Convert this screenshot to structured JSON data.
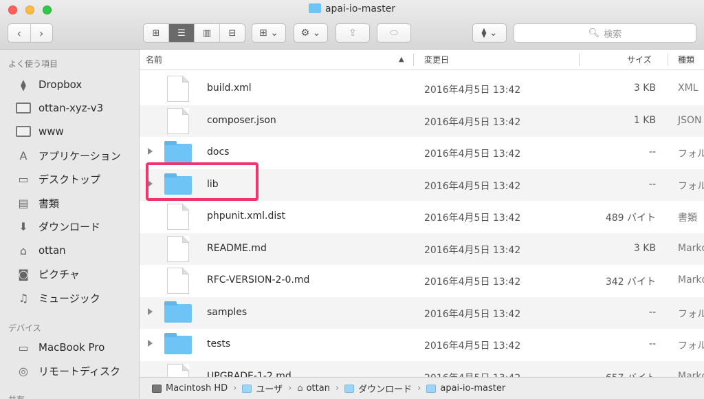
{
  "window": {
    "title": "apai-io-master"
  },
  "toolbar": {
    "back": "‹",
    "forward": "›",
    "views": [
      "⊞",
      "☰",
      "▥",
      "⊟"
    ],
    "arrange": "⊞ ⌄",
    "action": "⚙ ⌄",
    "share": "⇪",
    "tag": "⬭",
    "dropbox": "⧫ ⌄",
    "search_placeholder": "検索"
  },
  "sidebar": {
    "favorites_header": "よく使う項目",
    "favorites": [
      {
        "label": "Dropbox",
        "icon": "dropbox-icon"
      },
      {
        "label": "ottan-xyz-v3",
        "icon": "folder-icon"
      },
      {
        "label": "www",
        "icon": "folder-icon"
      },
      {
        "label": "アプリケーション",
        "icon": "applications-icon"
      },
      {
        "label": "デスクトップ",
        "icon": "desktop-icon"
      },
      {
        "label": "書類",
        "icon": "documents-icon"
      },
      {
        "label": "ダウンロード",
        "icon": "downloads-icon"
      },
      {
        "label": "ottan",
        "icon": "home-icon"
      },
      {
        "label": "ピクチャ",
        "icon": "pictures-icon"
      },
      {
        "label": "ミュージック",
        "icon": "music-icon"
      }
    ],
    "devices_header": "デバイス",
    "devices": [
      {
        "label": "MacBook Pro",
        "icon": "laptop-icon"
      },
      {
        "label": "リモートディスク",
        "icon": "disc-icon"
      }
    ],
    "third_header": "共有"
  },
  "columns": {
    "name": "名前",
    "modified": "変更日",
    "size": "サイズ",
    "kind": "種類"
  },
  "files": [
    {
      "name": "build.xml",
      "date": "2016年4月5日 13:42",
      "size": "3 KB",
      "kind": "XML",
      "type": "file"
    },
    {
      "name": "composer.json",
      "date": "2016年4月5日 13:42",
      "size": "1 KB",
      "kind": "JSON",
      "type": "file"
    },
    {
      "name": "docs",
      "date": "2016年4月5日 13:42",
      "size": "--",
      "kind": "フォルダ",
      "type": "folder"
    },
    {
      "name": "lib",
      "date": "2016年4月5日 13:42",
      "size": "--",
      "kind": "フォルダ",
      "type": "folder"
    },
    {
      "name": "phpunit.xml.dist",
      "date": "2016年4月5日 13:42",
      "size": "489 バイト",
      "kind": "書類",
      "type": "file"
    },
    {
      "name": "README.md",
      "date": "2016年4月5日 13:42",
      "size": "3 KB",
      "kind": "Markdown",
      "type": "file"
    },
    {
      "name": "RFC-VERSION-2-0.md",
      "date": "2016年4月5日 13:42",
      "size": "342 バイト",
      "kind": "Markdown",
      "type": "file"
    },
    {
      "name": "samples",
      "date": "2016年4月5日 13:42",
      "size": "--",
      "kind": "フォルダ",
      "type": "folder"
    },
    {
      "name": "tests",
      "date": "2016年4月5日 13:42",
      "size": "--",
      "kind": "フォルダ",
      "type": "folder"
    },
    {
      "name": "UPGRADE-1-2.md",
      "date": "2016年4月5日 13:42",
      "size": "657 バイト",
      "kind": "Markdown",
      "type": "file"
    }
  ],
  "highlight_color": "#f2336e",
  "pathbar": [
    "Macintosh HD",
    "ユーザ",
    "ottan",
    "ダウンロード",
    "apai-io-master"
  ]
}
